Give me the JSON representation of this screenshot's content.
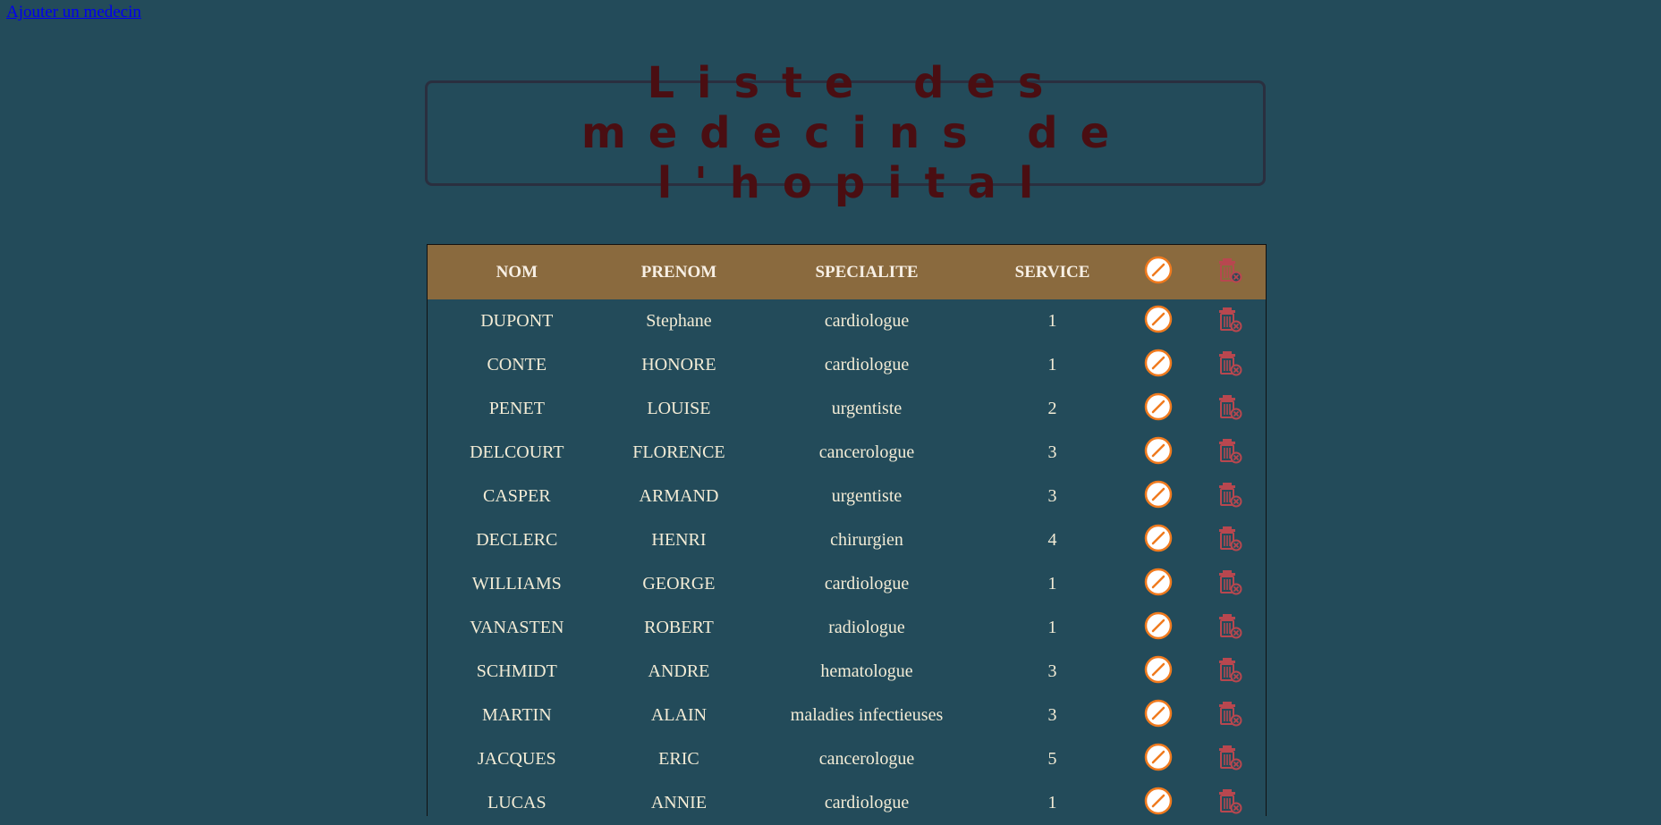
{
  "add_link": "Ajouter un medecin",
  "title": "Liste des medecins de l'hopital",
  "columns": {
    "nom": "NOM",
    "prenom": "PRENOM",
    "specialite": "SPECIALITE",
    "service": "SERVICE",
    "edit_icon": "edit-icon",
    "delete_icon": "trash-icon"
  },
  "colors": {
    "background": "#234b5a",
    "header_bg": "#8a6a3e",
    "title_text": "#4a0e12",
    "edit_icon": "#f07a1e",
    "trash_icon": "#b8474f"
  },
  "rows": [
    {
      "nom": "DUPONT",
      "prenom": "Stephane",
      "specialite": "cardiologue",
      "service": "1"
    },
    {
      "nom": "CONTE",
      "prenom": "HONORE",
      "specialite": "cardiologue",
      "service": "1"
    },
    {
      "nom": "PENET",
      "prenom": "LOUISE",
      "specialite": "urgentiste",
      "service": "2"
    },
    {
      "nom": "DELCOURT",
      "prenom": "FLORENCE",
      "specialite": "cancerologue",
      "service": "3"
    },
    {
      "nom": "CASPER",
      "prenom": "ARMAND",
      "specialite": "urgentiste",
      "service": "3"
    },
    {
      "nom": "DECLERC",
      "prenom": "HENRI",
      "specialite": "chirurgien",
      "service": "4"
    },
    {
      "nom": "WILLIAMS",
      "prenom": "GEORGE",
      "specialite": "cardiologue",
      "service": "1"
    },
    {
      "nom": "VANASTEN",
      "prenom": "ROBERT",
      "specialite": "radiologue",
      "service": "1"
    },
    {
      "nom": "SCHMIDT",
      "prenom": "ANDRE",
      "specialite": "hematologue",
      "service": "3"
    },
    {
      "nom": "MARTIN",
      "prenom": "ALAIN",
      "specialite": "maladies infectieuses",
      "service": "3"
    },
    {
      "nom": "JACQUES",
      "prenom": "ERIC",
      "specialite": "cancerologue",
      "service": "5"
    },
    {
      "nom": "LUCAS",
      "prenom": "ANNIE",
      "specialite": "cardiologue",
      "service": "1"
    }
  ]
}
